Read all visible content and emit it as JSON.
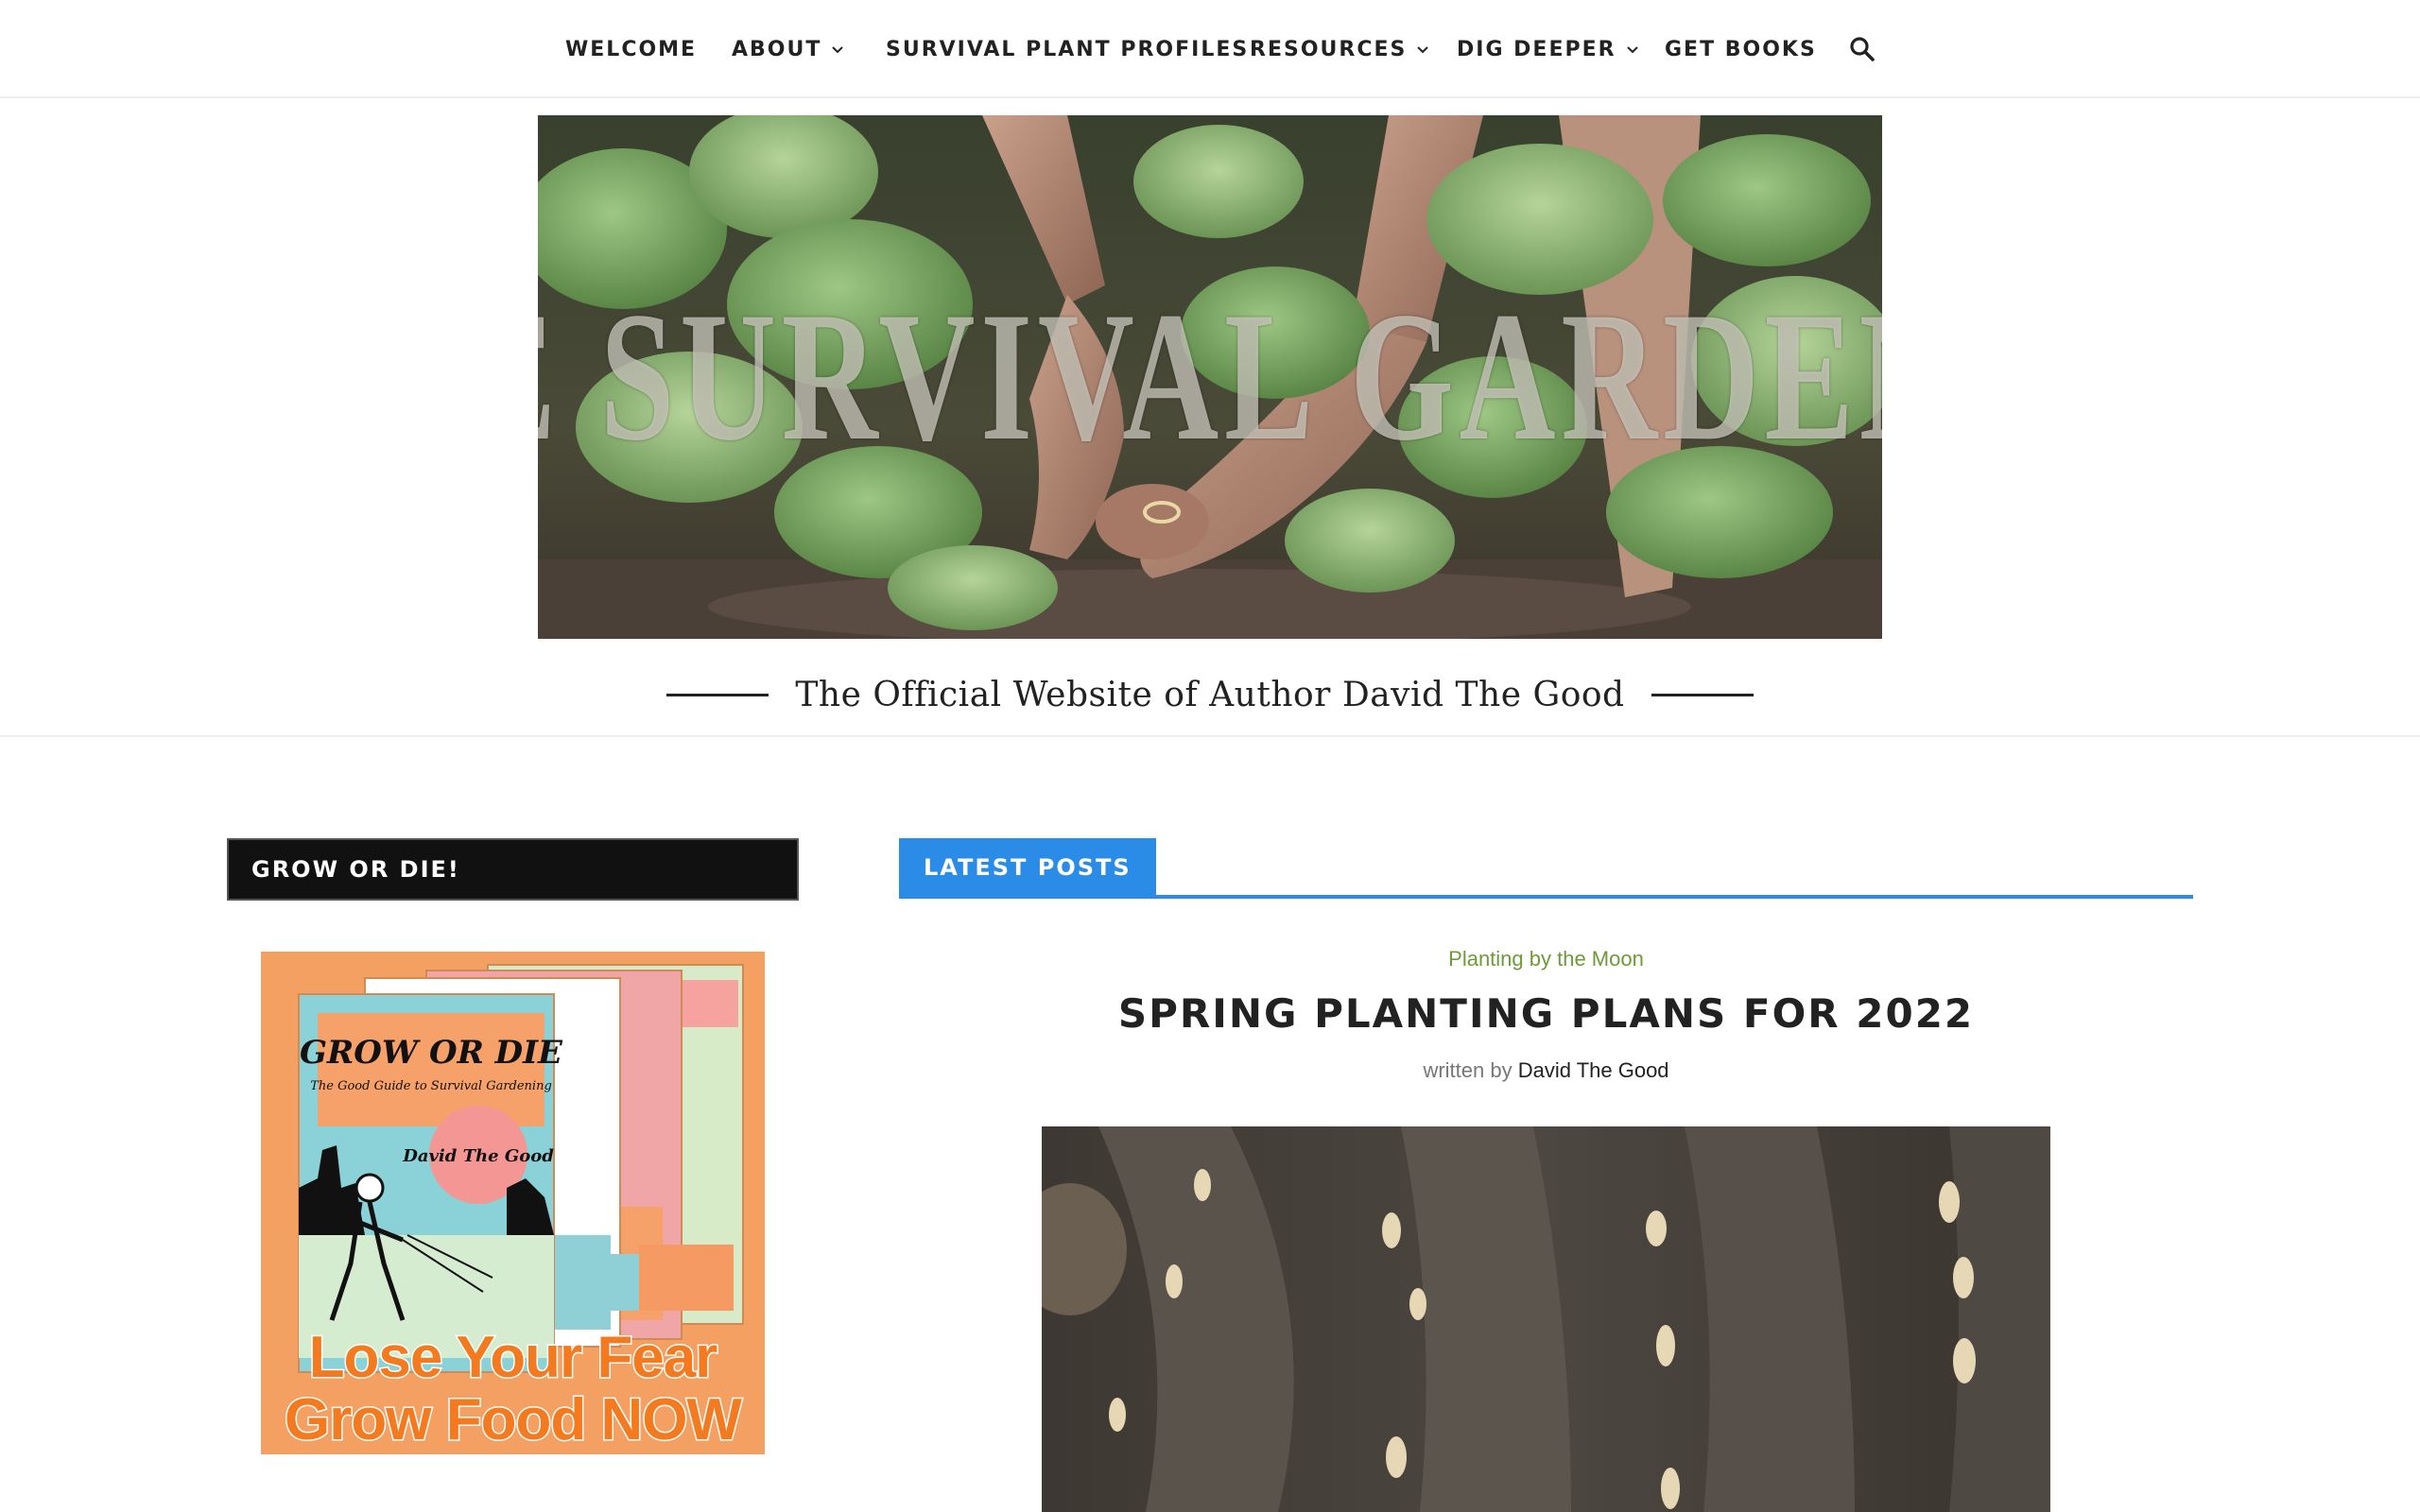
{
  "nav": {
    "items": [
      {
        "label": "WELCOME",
        "has_dropdown": false
      },
      {
        "label": "ABOUT",
        "has_dropdown": true
      },
      {
        "label": "SURVIVAL PLANT PROFILES",
        "has_dropdown": false
      },
      {
        "label": "RESOURCES",
        "has_dropdown": true
      },
      {
        "label": "DIG DEEPER",
        "has_dropdown": true
      },
      {
        "label": "GET BOOKS",
        "has_dropdown": false
      }
    ],
    "search_icon": "search-icon"
  },
  "header": {
    "site_title": "THE SURVIVAL GARDENER",
    "tagline": "The Official Website of Author David The Good"
  },
  "sidebar": {
    "widget_title": "GROW OR DIE!",
    "ad": {
      "book_title": "GROW OR DIE",
      "book_subtitle": "The Good Guide to Survival Gardening",
      "author": "David The Good",
      "line1": "Lose Your Fear",
      "line2": "Grow Food NOW"
    }
  },
  "latest": {
    "section_title": "LATEST POSTS",
    "post": {
      "category": "Planting by the Moon",
      "title": "SPRING PLANTING PLANS FOR 2022",
      "written_by": "written by",
      "author": "David The Good"
    }
  },
  "colors": {
    "accent": "#2b8ce8",
    "category": "#6e9a3b",
    "widget_bg": "#111111",
    "ad_bg": "#f4a063",
    "ad_text": "#f47a20"
  }
}
